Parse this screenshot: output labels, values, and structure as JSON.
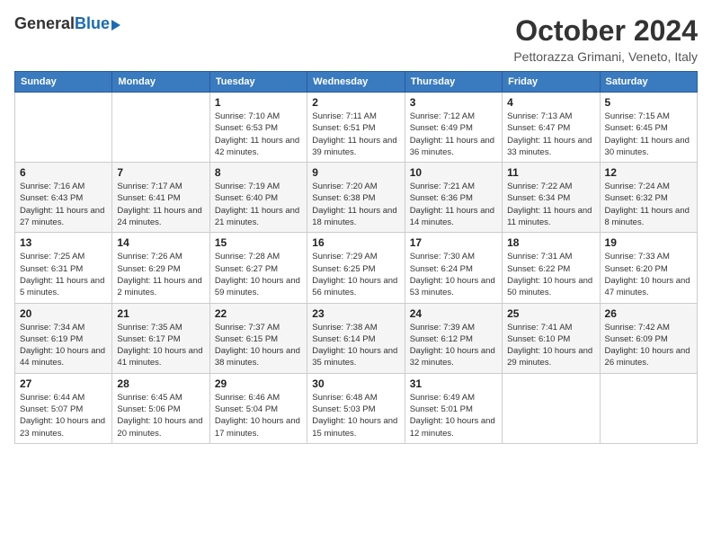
{
  "logo": {
    "general": "General",
    "blue": "Blue"
  },
  "title": "October 2024",
  "location": "Pettorazza Grimani, Veneto, Italy",
  "headers": [
    "Sunday",
    "Monday",
    "Tuesday",
    "Wednesday",
    "Thursday",
    "Friday",
    "Saturday"
  ],
  "weeks": [
    [
      {
        "day": "",
        "sunrise": "",
        "sunset": "",
        "daylight": ""
      },
      {
        "day": "",
        "sunrise": "",
        "sunset": "",
        "daylight": ""
      },
      {
        "day": "1",
        "sunrise": "Sunrise: 7:10 AM",
        "sunset": "Sunset: 6:53 PM",
        "daylight": "Daylight: 11 hours and 42 minutes."
      },
      {
        "day": "2",
        "sunrise": "Sunrise: 7:11 AM",
        "sunset": "Sunset: 6:51 PM",
        "daylight": "Daylight: 11 hours and 39 minutes."
      },
      {
        "day": "3",
        "sunrise": "Sunrise: 7:12 AM",
        "sunset": "Sunset: 6:49 PM",
        "daylight": "Daylight: 11 hours and 36 minutes."
      },
      {
        "day": "4",
        "sunrise": "Sunrise: 7:13 AM",
        "sunset": "Sunset: 6:47 PM",
        "daylight": "Daylight: 11 hours and 33 minutes."
      },
      {
        "day": "5",
        "sunrise": "Sunrise: 7:15 AM",
        "sunset": "Sunset: 6:45 PM",
        "daylight": "Daylight: 11 hours and 30 minutes."
      }
    ],
    [
      {
        "day": "6",
        "sunrise": "Sunrise: 7:16 AM",
        "sunset": "Sunset: 6:43 PM",
        "daylight": "Daylight: 11 hours and 27 minutes."
      },
      {
        "day": "7",
        "sunrise": "Sunrise: 7:17 AM",
        "sunset": "Sunset: 6:41 PM",
        "daylight": "Daylight: 11 hours and 24 minutes."
      },
      {
        "day": "8",
        "sunrise": "Sunrise: 7:19 AM",
        "sunset": "Sunset: 6:40 PM",
        "daylight": "Daylight: 11 hours and 21 minutes."
      },
      {
        "day": "9",
        "sunrise": "Sunrise: 7:20 AM",
        "sunset": "Sunset: 6:38 PM",
        "daylight": "Daylight: 11 hours and 18 minutes."
      },
      {
        "day": "10",
        "sunrise": "Sunrise: 7:21 AM",
        "sunset": "Sunset: 6:36 PM",
        "daylight": "Daylight: 11 hours and 14 minutes."
      },
      {
        "day": "11",
        "sunrise": "Sunrise: 7:22 AM",
        "sunset": "Sunset: 6:34 PM",
        "daylight": "Daylight: 11 hours and 11 minutes."
      },
      {
        "day": "12",
        "sunrise": "Sunrise: 7:24 AM",
        "sunset": "Sunset: 6:32 PM",
        "daylight": "Daylight: 11 hours and 8 minutes."
      }
    ],
    [
      {
        "day": "13",
        "sunrise": "Sunrise: 7:25 AM",
        "sunset": "Sunset: 6:31 PM",
        "daylight": "Daylight: 11 hours and 5 minutes."
      },
      {
        "day": "14",
        "sunrise": "Sunrise: 7:26 AM",
        "sunset": "Sunset: 6:29 PM",
        "daylight": "Daylight: 11 hours and 2 minutes."
      },
      {
        "day": "15",
        "sunrise": "Sunrise: 7:28 AM",
        "sunset": "Sunset: 6:27 PM",
        "daylight": "Daylight: 10 hours and 59 minutes."
      },
      {
        "day": "16",
        "sunrise": "Sunrise: 7:29 AM",
        "sunset": "Sunset: 6:25 PM",
        "daylight": "Daylight: 10 hours and 56 minutes."
      },
      {
        "day": "17",
        "sunrise": "Sunrise: 7:30 AM",
        "sunset": "Sunset: 6:24 PM",
        "daylight": "Daylight: 10 hours and 53 minutes."
      },
      {
        "day": "18",
        "sunrise": "Sunrise: 7:31 AM",
        "sunset": "Sunset: 6:22 PM",
        "daylight": "Daylight: 10 hours and 50 minutes."
      },
      {
        "day": "19",
        "sunrise": "Sunrise: 7:33 AM",
        "sunset": "Sunset: 6:20 PM",
        "daylight": "Daylight: 10 hours and 47 minutes."
      }
    ],
    [
      {
        "day": "20",
        "sunrise": "Sunrise: 7:34 AM",
        "sunset": "Sunset: 6:19 PM",
        "daylight": "Daylight: 10 hours and 44 minutes."
      },
      {
        "day": "21",
        "sunrise": "Sunrise: 7:35 AM",
        "sunset": "Sunset: 6:17 PM",
        "daylight": "Daylight: 10 hours and 41 minutes."
      },
      {
        "day": "22",
        "sunrise": "Sunrise: 7:37 AM",
        "sunset": "Sunset: 6:15 PM",
        "daylight": "Daylight: 10 hours and 38 minutes."
      },
      {
        "day": "23",
        "sunrise": "Sunrise: 7:38 AM",
        "sunset": "Sunset: 6:14 PM",
        "daylight": "Daylight: 10 hours and 35 minutes."
      },
      {
        "day": "24",
        "sunrise": "Sunrise: 7:39 AM",
        "sunset": "Sunset: 6:12 PM",
        "daylight": "Daylight: 10 hours and 32 minutes."
      },
      {
        "day": "25",
        "sunrise": "Sunrise: 7:41 AM",
        "sunset": "Sunset: 6:10 PM",
        "daylight": "Daylight: 10 hours and 29 minutes."
      },
      {
        "day": "26",
        "sunrise": "Sunrise: 7:42 AM",
        "sunset": "Sunset: 6:09 PM",
        "daylight": "Daylight: 10 hours and 26 minutes."
      }
    ],
    [
      {
        "day": "27",
        "sunrise": "Sunrise: 6:44 AM",
        "sunset": "Sunset: 5:07 PM",
        "daylight": "Daylight: 10 hours and 23 minutes."
      },
      {
        "day": "28",
        "sunrise": "Sunrise: 6:45 AM",
        "sunset": "Sunset: 5:06 PM",
        "daylight": "Daylight: 10 hours and 20 minutes."
      },
      {
        "day": "29",
        "sunrise": "Sunrise: 6:46 AM",
        "sunset": "Sunset: 5:04 PM",
        "daylight": "Daylight: 10 hours and 17 minutes."
      },
      {
        "day": "30",
        "sunrise": "Sunrise: 6:48 AM",
        "sunset": "Sunset: 5:03 PM",
        "daylight": "Daylight: 10 hours and 15 minutes."
      },
      {
        "day": "31",
        "sunrise": "Sunrise: 6:49 AM",
        "sunset": "Sunset: 5:01 PM",
        "daylight": "Daylight: 10 hours and 12 minutes."
      },
      {
        "day": "",
        "sunrise": "",
        "sunset": "",
        "daylight": ""
      },
      {
        "day": "",
        "sunrise": "",
        "sunset": "",
        "daylight": ""
      }
    ]
  ]
}
